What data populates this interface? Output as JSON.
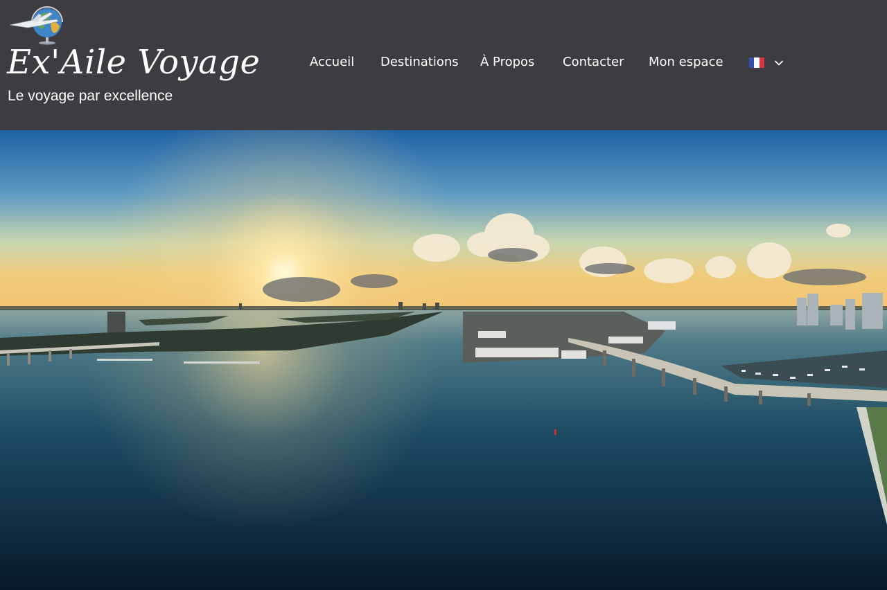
{
  "header": {
    "site_title": "Ex'Aile Voyage",
    "tagline": "Le voyage par excellence"
  },
  "nav": {
    "items": [
      {
        "label": "Accueil"
      },
      {
        "label": "Destinations"
      },
      {
        "label": "À Propos"
      },
      {
        "label": "Contacter"
      },
      {
        "label": "Mon espace"
      }
    ]
  },
  "language": {
    "flag": "france-flag-icon",
    "colors": [
      "#3152b0",
      "#ffffff",
      "#d8363b"
    ]
  },
  "theme": {
    "header_bg": "#3d3c40",
    "nav_text": "#ffffff"
  },
  "hero": {
    "image": "panoramic aerial view of a bay at sunset"
  }
}
